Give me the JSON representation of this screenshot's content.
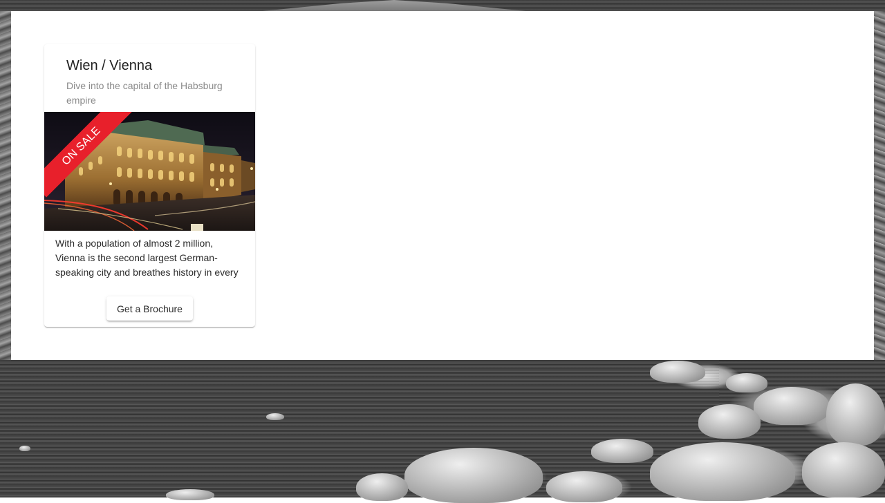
{
  "card": {
    "title": "Wien / Vienna",
    "subtitle": "Dive into the capital of the Habsburg empire",
    "ribbon": "ON SALE",
    "ribbon_color": "#e8202b",
    "description": "With a population of almost 2 million, Vienna is the second largest German-speaking city and breathes history in every",
    "button_label": "Get a Brochure"
  }
}
